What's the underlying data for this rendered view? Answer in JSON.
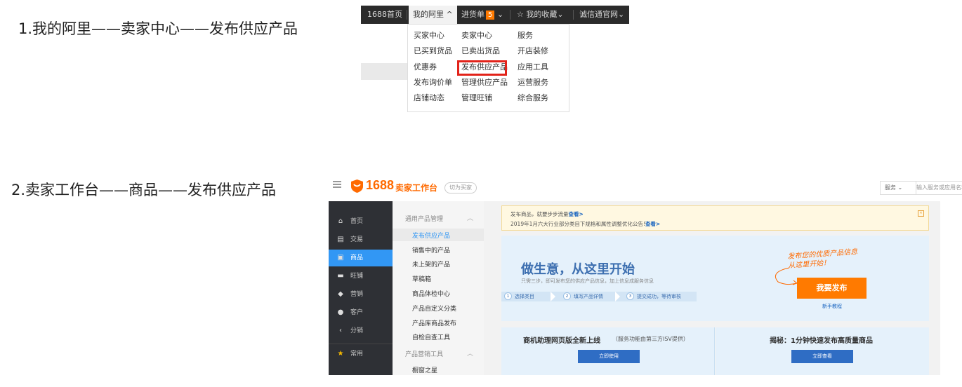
{
  "captions": {
    "step1": "1.我的阿里——卖家中心——发布供应产品",
    "step2": "2.卖家工作台——商品——发布供应产品"
  },
  "topbar": {
    "home": "1688首页",
    "my_ali": "我的阿里",
    "cart": "进货单",
    "cart_count": "5",
    "favorites": "我的收藏",
    "official": "诚信通官网"
  },
  "dropdown": {
    "col1": [
      "买家中心",
      "已买到货品",
      "优惠券",
      "发布询价单",
      "店铺动态"
    ],
    "col2": [
      "卖家中心",
      "已卖出货品",
      "发布供应产品",
      "管理供应产品",
      "管理旺铺"
    ],
    "col3": [
      "服务",
      "开店装修",
      "应用工具",
      "运营服务",
      "综合服务"
    ]
  },
  "workbench": {
    "logo_number": "1688",
    "logo_title": "卖家工作台",
    "switch_buyer": "切为买家",
    "service_select": "服务",
    "search_placeholder": "输入服务或应用名称",
    "nav": [
      {
        "icon": "home-icon",
        "label": "首页"
      },
      {
        "icon": "clipboard-icon",
        "label": "交易"
      },
      {
        "icon": "box-icon",
        "label": "商品"
      },
      {
        "icon": "store-icon",
        "label": "旺铺"
      },
      {
        "icon": "tag-icon",
        "label": "营销"
      },
      {
        "icon": "user-icon",
        "label": "客户"
      },
      {
        "icon": "share-icon",
        "label": "分销"
      },
      {
        "icon": "star-icon",
        "label": "常用"
      }
    ],
    "sub_groups": {
      "group1": "通用产品管理",
      "group1_items": [
        "发布供应产品",
        "销售中的产品",
        "未上架的产品",
        "草稿箱",
        "商品体检中心",
        "产品自定义分类",
        "产品库商品发布",
        "自检自查工具"
      ],
      "group2": "产品营销工具",
      "group2_items": [
        "橱窗之星"
      ]
    },
    "notice": {
      "line1_text": "发布商品，就要步步流量",
      "line1_link": "查看>",
      "line2_text": "2019年1月六大行业部分类目下规格和属性调整优化公告!",
      "line2_link": "查看>"
    },
    "hero": {
      "title": "做生意，从这里开始",
      "subtitle": "只需三步，即可发布您的供应产品信息，加上信息成服务信息",
      "steps": [
        {
          "num": "1",
          "label": "选择类目"
        },
        {
          "num": "2",
          "label": "填写产品详情"
        },
        {
          "num": "3",
          "label": "提交成功，等待审核"
        }
      ],
      "hint_line1": "发布您的优质产品信息",
      "hint_line2": "从这里开始！",
      "publish_button": "我要发布",
      "newbie_link": "新手教程"
    },
    "cards": {
      "left_title": "商机助理网页版全新上线",
      "left_note": "（服务功能由第三方ISV提供）",
      "left_button": "立即使用",
      "right_title": "揭秘：1分钟快速发布高质量商品",
      "right_button": "立即查看"
    }
  },
  "colors": {
    "accent_orange": "#ff6a00",
    "highlight_red": "#e2231a",
    "nav_active_blue": "#3297f4",
    "card_button_blue": "#2f6dc4"
  }
}
